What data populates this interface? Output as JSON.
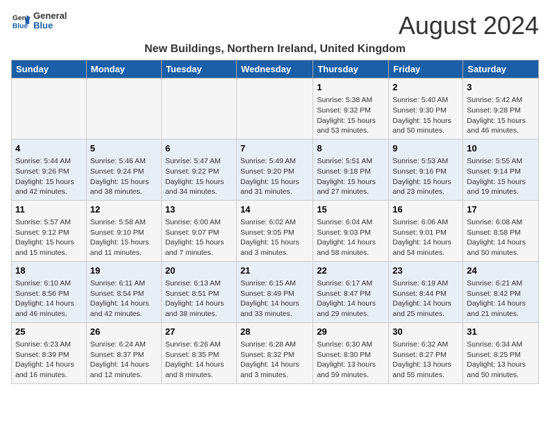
{
  "header": {
    "logo_general": "General",
    "logo_blue": "Blue",
    "title": "August 2024",
    "subtitle": "New Buildings, Northern Ireland, United Kingdom"
  },
  "days_of_week": [
    "Sunday",
    "Monday",
    "Tuesday",
    "Wednesday",
    "Thursday",
    "Friday",
    "Saturday"
  ],
  "weeks": [
    [
      {
        "day": "",
        "info": ""
      },
      {
        "day": "",
        "info": ""
      },
      {
        "day": "",
        "info": ""
      },
      {
        "day": "",
        "info": ""
      },
      {
        "day": "1",
        "info": "Sunrise: 5:38 AM\nSunset: 9:32 PM\nDaylight: 15 hours\nand 53 minutes."
      },
      {
        "day": "2",
        "info": "Sunrise: 5:40 AM\nSunset: 9:30 PM\nDaylight: 15 hours\nand 50 minutes."
      },
      {
        "day": "3",
        "info": "Sunrise: 5:42 AM\nSunset: 9:28 PM\nDaylight: 15 hours\nand 46 minutes."
      }
    ],
    [
      {
        "day": "4",
        "info": "Sunrise: 5:44 AM\nSunset: 9:26 PM\nDaylight: 15 hours\nand 42 minutes."
      },
      {
        "day": "5",
        "info": "Sunrise: 5:46 AM\nSunset: 9:24 PM\nDaylight: 15 hours\nand 38 minutes."
      },
      {
        "day": "6",
        "info": "Sunrise: 5:47 AM\nSunset: 9:22 PM\nDaylight: 15 hours\nand 34 minutes."
      },
      {
        "day": "7",
        "info": "Sunrise: 5:49 AM\nSunset: 9:20 PM\nDaylight: 15 hours\nand 31 minutes."
      },
      {
        "day": "8",
        "info": "Sunrise: 5:51 AM\nSunset: 9:18 PM\nDaylight: 15 hours\nand 27 minutes."
      },
      {
        "day": "9",
        "info": "Sunrise: 5:53 AM\nSunset: 9:16 PM\nDaylight: 15 hours\nand 23 minutes."
      },
      {
        "day": "10",
        "info": "Sunrise: 5:55 AM\nSunset: 9:14 PM\nDaylight: 15 hours\nand 19 minutes."
      }
    ],
    [
      {
        "day": "11",
        "info": "Sunrise: 5:57 AM\nSunset: 9:12 PM\nDaylight: 15 hours\nand 15 minutes."
      },
      {
        "day": "12",
        "info": "Sunrise: 5:58 AM\nSunset: 9:10 PM\nDaylight: 15 hours\nand 11 minutes."
      },
      {
        "day": "13",
        "info": "Sunrise: 6:00 AM\nSunset: 9:07 PM\nDaylight: 15 hours\nand 7 minutes."
      },
      {
        "day": "14",
        "info": "Sunrise: 6:02 AM\nSunset: 9:05 PM\nDaylight: 15 hours\nand 3 minutes."
      },
      {
        "day": "15",
        "info": "Sunrise: 6:04 AM\nSunset: 9:03 PM\nDaylight: 14 hours\nand 58 minutes."
      },
      {
        "day": "16",
        "info": "Sunrise: 6:06 AM\nSunset: 9:01 PM\nDaylight: 14 hours\nand 54 minutes."
      },
      {
        "day": "17",
        "info": "Sunrise: 6:08 AM\nSunset: 8:58 PM\nDaylight: 14 hours\nand 50 minutes."
      }
    ],
    [
      {
        "day": "18",
        "info": "Sunrise: 6:10 AM\nSunset: 8:56 PM\nDaylight: 14 hours\nand 46 minutes."
      },
      {
        "day": "19",
        "info": "Sunrise: 6:11 AM\nSunset: 8:54 PM\nDaylight: 14 hours\nand 42 minutes."
      },
      {
        "day": "20",
        "info": "Sunrise: 6:13 AM\nSunset: 8:51 PM\nDaylight: 14 hours\nand 38 minutes."
      },
      {
        "day": "21",
        "info": "Sunrise: 6:15 AM\nSunset: 8:49 PM\nDaylight: 14 hours\nand 33 minutes."
      },
      {
        "day": "22",
        "info": "Sunrise: 6:17 AM\nSunset: 8:47 PM\nDaylight: 14 hours\nand 29 minutes."
      },
      {
        "day": "23",
        "info": "Sunrise: 6:19 AM\nSunset: 8:44 PM\nDaylight: 14 hours\nand 25 minutes."
      },
      {
        "day": "24",
        "info": "Sunrise: 6:21 AM\nSunset: 8:42 PM\nDaylight: 14 hours\nand 21 minutes."
      }
    ],
    [
      {
        "day": "25",
        "info": "Sunrise: 6:23 AM\nSunset: 8:39 PM\nDaylight: 14 hours\nand 16 minutes."
      },
      {
        "day": "26",
        "info": "Sunrise: 6:24 AM\nSunset: 8:37 PM\nDaylight: 14 hours\nand 12 minutes."
      },
      {
        "day": "27",
        "info": "Sunrise: 6:26 AM\nSunset: 8:35 PM\nDaylight: 14 hours\nand 8 minutes."
      },
      {
        "day": "28",
        "info": "Sunrise: 6:28 AM\nSunset: 8:32 PM\nDaylight: 14 hours\nand 3 minutes."
      },
      {
        "day": "29",
        "info": "Sunrise: 6:30 AM\nSunset: 8:30 PM\nDaylight: 13 hours\nand 59 minutes."
      },
      {
        "day": "30",
        "info": "Sunrise: 6:32 AM\nSunset: 8:27 PM\nDaylight: 13 hours\nand 55 minutes."
      },
      {
        "day": "31",
        "info": "Sunrise: 6:34 AM\nSunset: 8:25 PM\nDaylight: 13 hours\nand 50 minutes."
      }
    ]
  ]
}
